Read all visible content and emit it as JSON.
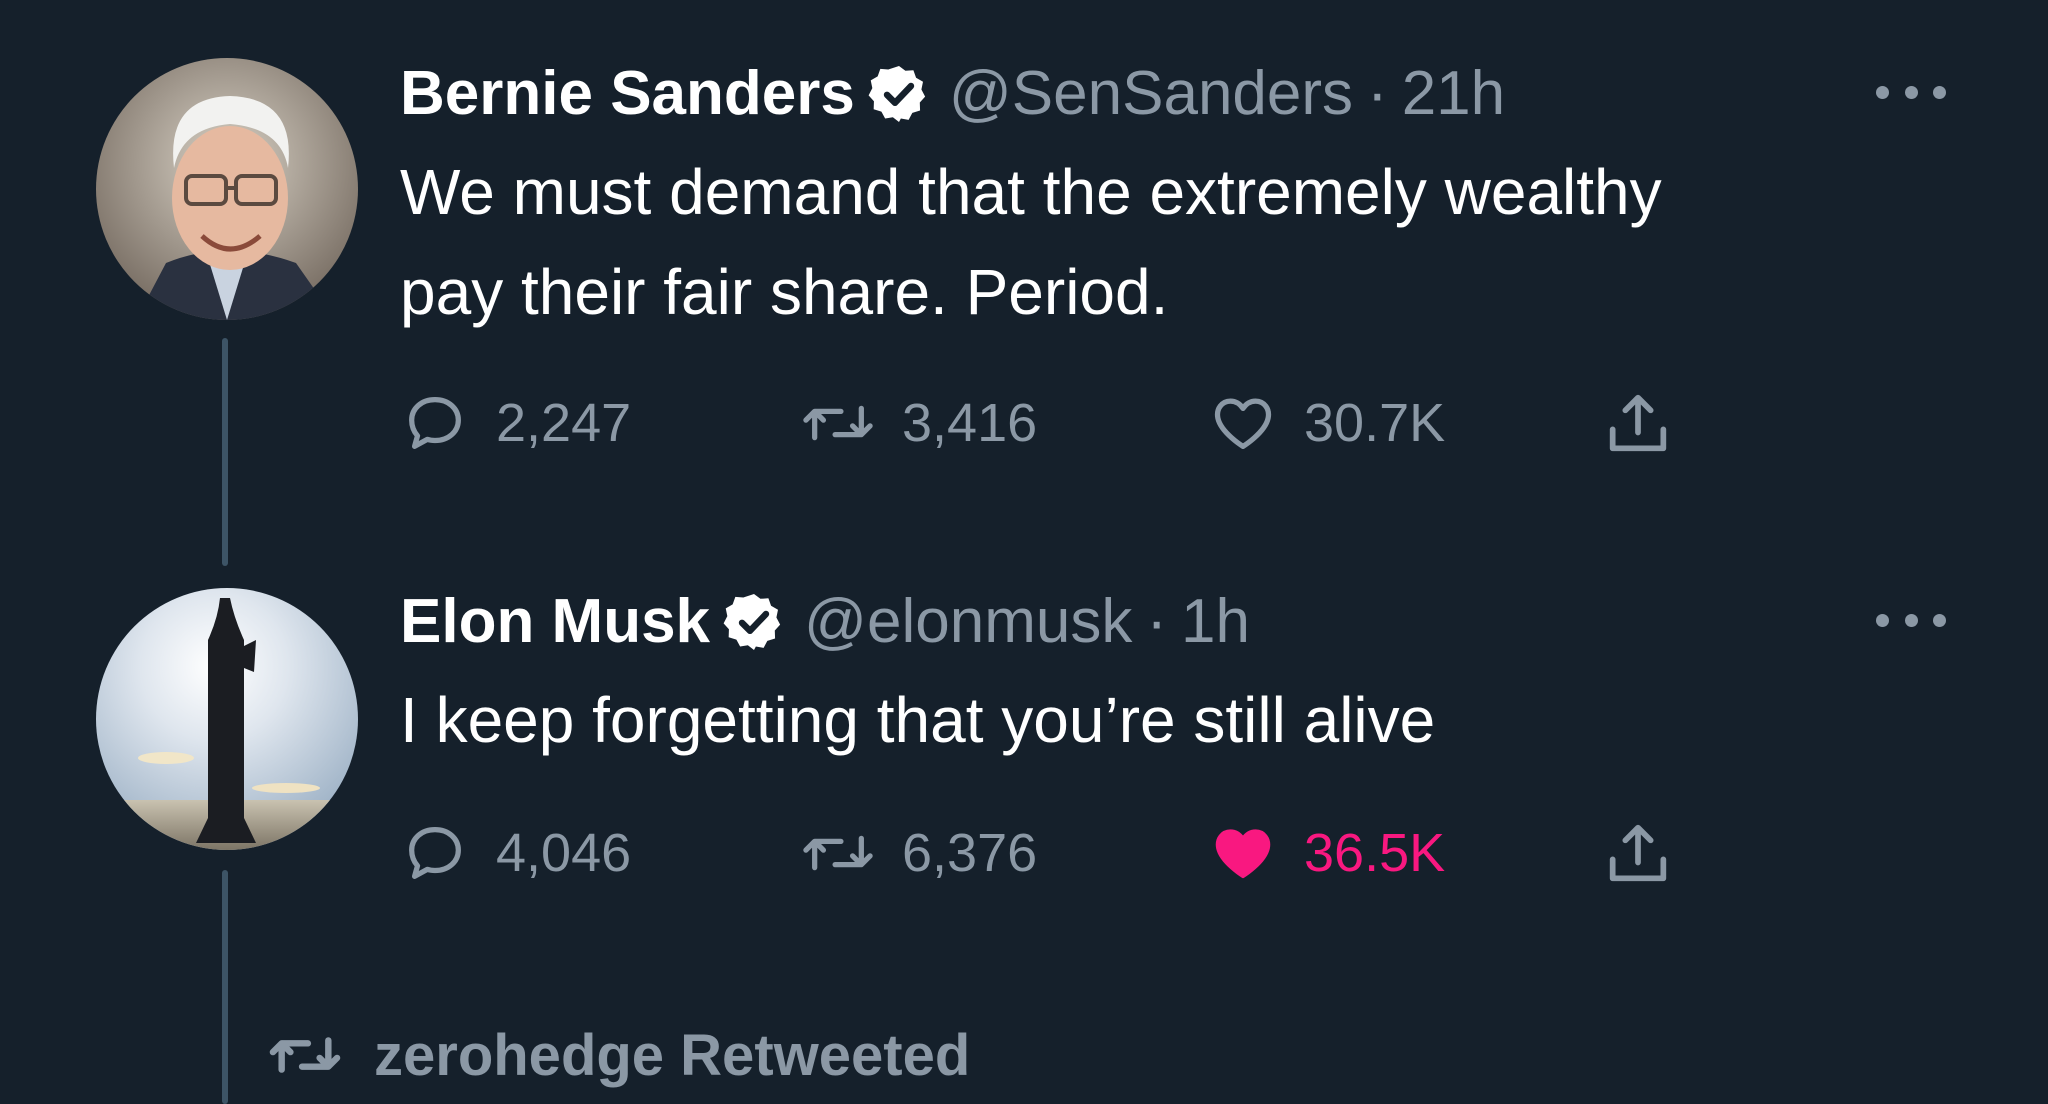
{
  "tweets": [
    {
      "display_name": "Bernie Sanders",
      "handle": "@SenSanders",
      "separator": "·",
      "time": "21h",
      "text_line1": "We must demand that the extremely wealthy",
      "text_line2": "pay their fair share. Period.",
      "replies": "2,247",
      "retweets": "3,416",
      "likes": "30.7K",
      "liked": false,
      "verified": true,
      "avatar": "portrait-avatar"
    },
    {
      "display_name": "Elon Musk",
      "handle": "@elonmusk",
      "separator": "·",
      "time": "1h",
      "text_line1": "I keep forgetting that you’re still alive",
      "replies": "4,046",
      "retweets": "6,376",
      "likes": "36.5K",
      "liked": true,
      "verified": true,
      "avatar": "rocket-avatar"
    }
  ],
  "retweeted_by": {
    "text": "zerohedge Retweeted",
    "icon": "retweet-icon"
  },
  "colors": {
    "background": "#15202b",
    "text_primary": "#ffffff",
    "text_secondary": "#8b98a5",
    "like_active": "#f91880",
    "thread_line": "#3d5466"
  },
  "icons": [
    "reply-icon",
    "retweet-icon",
    "like-icon",
    "share-icon",
    "verified-badge-icon",
    "more-options-icon"
  ]
}
